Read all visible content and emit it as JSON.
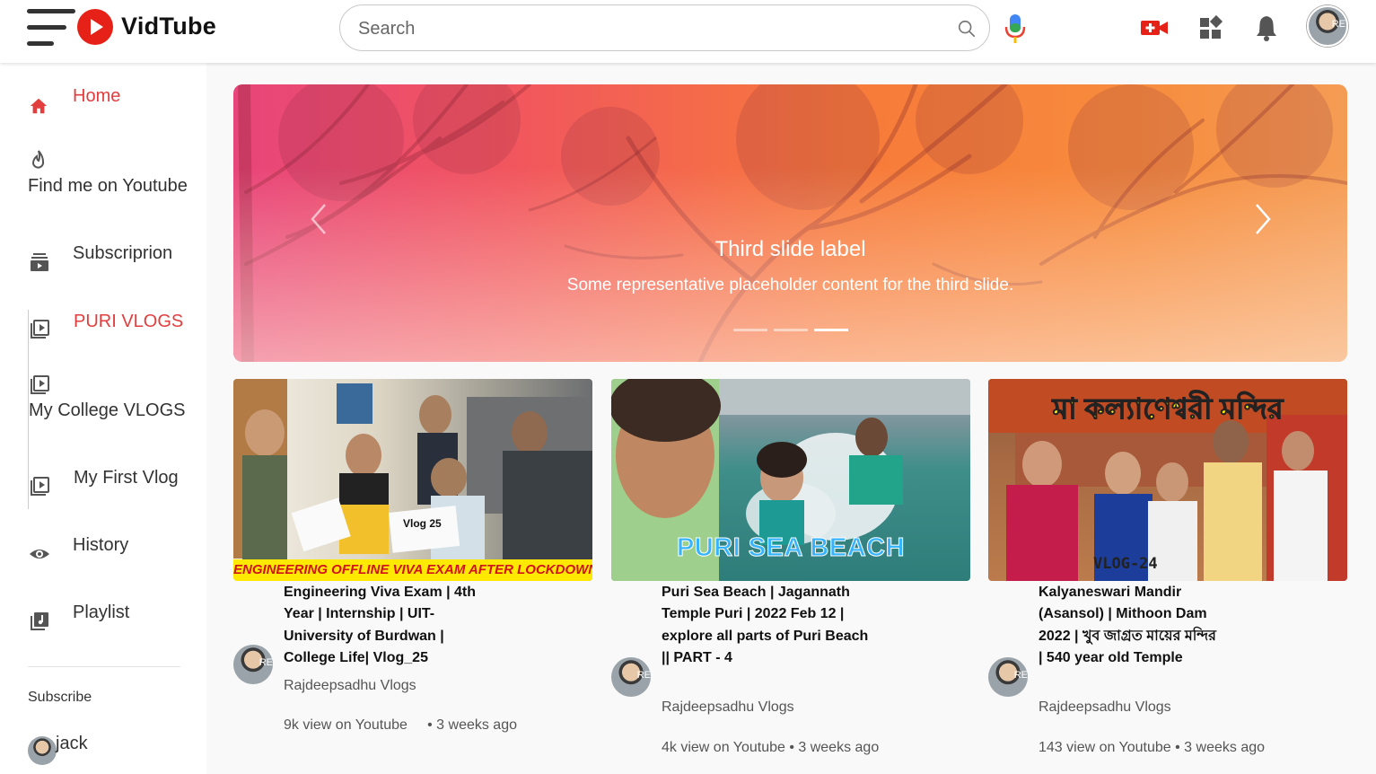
{
  "header": {
    "logo_text": "VidTube",
    "search_placeholder": "Search",
    "icons": [
      "menu-icon",
      "logo-play-icon",
      "search-icon",
      "mic-icon",
      "create-video-icon",
      "apps-icon",
      "notification-bell-icon",
      "user-avatar"
    ],
    "accent_color": "#e62117"
  },
  "sidebar": {
    "items": [
      {
        "label": "Home",
        "icon": "home-icon",
        "active": true
      },
      {
        "label": "Find me on Youtube",
        "icon": "fire-icon"
      },
      {
        "label": "Subscriprion",
        "icon": "subscriptions-icon"
      },
      {
        "label": "PURI VLOGS",
        "icon": "playlist-play-icon",
        "active": true
      },
      {
        "label": "My College VLOGS",
        "icon": "playlist-play-icon"
      },
      {
        "label": "My First Vlog",
        "icon": "playlist-play-icon"
      },
      {
        "label": "History",
        "icon": "eye-icon"
      },
      {
        "label": "Playlist",
        "icon": "library-icon"
      }
    ],
    "subscribe_heading": "Subscribe",
    "subscriptions": [
      {
        "name": "jack"
      }
    ]
  },
  "carousel": {
    "title": "Third slide label",
    "text": "Some representative placeholder content for the third slide.",
    "slide_count": 3,
    "active_slide": 3
  },
  "videos": [
    {
      "title": "Engineering Viva Exam | 4th Year | Internship | UIT-University of Burdwan | College Life| Vlog_25",
      "thumb_text": "ENGINEERING OFFLINE VIVA EXAM AFTER LOCKDOWN",
      "thumb_sign": "Vlog 25",
      "channel": "Rajdeepsadhu Vlogs",
      "meta": "9k view on Youtube     • 3 weeks ago"
    },
    {
      "title": "Puri Sea Beach | Jagannath Temple Puri | 2022 Feb 12 | explore all parts of Puri Beach || PART - 4",
      "thumb_text": "PURI SEA BEACH",
      "channel": "Rajdeepsadhu Vlogs",
      "meta": "4k view on Youtube • 3 weeks ago"
    },
    {
      "title": "Kalyaneswari Mandir (Asansol) | Mithoon Dam 2022 | খুব জাগ্রত মায়ের মন্দির | 540 year old Temple",
      "thumb_text": "মা কল্যাণেশ্বরী মন্দির",
      "thumb_sign": "VLOG-24",
      "channel": "Rajdeepsadhu Vlogs",
      "meta": "143 view on Youtube • 3 weeks ago"
    }
  ]
}
